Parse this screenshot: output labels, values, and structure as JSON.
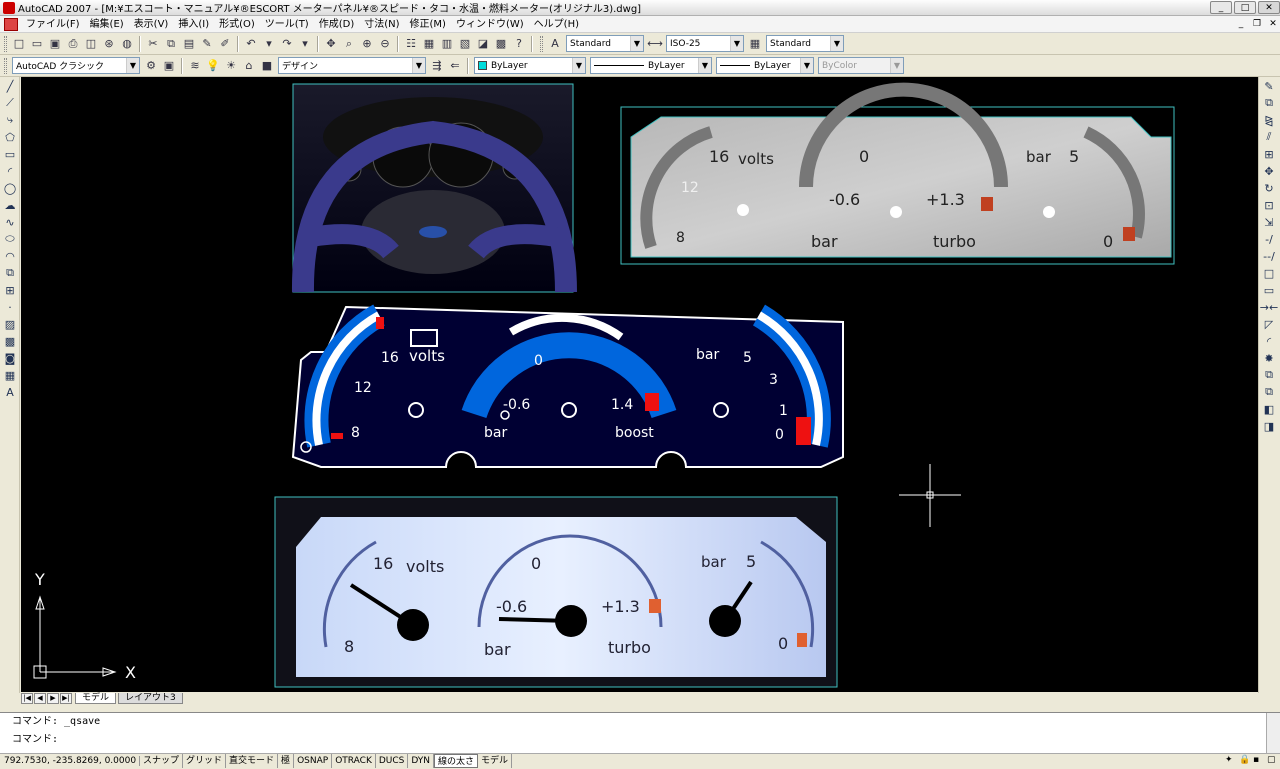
{
  "window": {
    "title": "AutoCAD 2007 - [M:¥エスコート・マニュアル¥®ESCORT メーターパネル¥®スピード・タコ・水温・燃料メーター(オリジナル3).dwg]"
  },
  "menu": [
    "ファイル(F)",
    "編集(E)",
    "表示(V)",
    "挿入(I)",
    "形式(O)",
    "ツール(T)",
    "作成(D)",
    "寸法(N)",
    "修正(M)",
    "ウィンドウ(W)",
    "ヘルプ(H)"
  ],
  "toolbar1": {
    "text_style": "Standard",
    "dim_style": "ISO-25",
    "table_style": "Standard"
  },
  "toolbar2": {
    "workspace": "AutoCAD クラシック",
    "layer": "デザイン",
    "color": "ByLayer",
    "linetype": "ByLayer",
    "lineweight": "ByLayer",
    "plotstyle": "ByColor"
  },
  "tabs": [
    "モデル",
    "レイアウト3"
  ],
  "command": {
    "history": "コマンド: _qsave",
    "prompt": "コマンド:"
  },
  "status": {
    "coords": "792.7530, -235.8269, 0.0000",
    "buttons": [
      "スナップ",
      "グリッド",
      "直交モード",
      "極",
      "OSNAP",
      "OTRACK",
      "DUCS",
      "DYN",
      "線の太さ",
      "モデル"
    ]
  },
  "ucs": {
    "x": "X",
    "y": "Y"
  },
  "gauge_labels": {
    "volts": "volts",
    "v16": "16",
    "v12": "12",
    "v8": "8",
    "b0": "0",
    "bneg": "-0.6",
    "bpos13": "+1.3",
    "bpos14": "1.4",
    "bar": "bar",
    "turbo": "turbo",
    "boost": "boost",
    "o5": "5",
    "o3": "3",
    "o1": "1",
    "o0": "0"
  },
  "colors": {
    "canvas": "#000000",
    "blue": "#0066dd",
    "navy": "#000033",
    "red": "#ee1111",
    "teal": "#40c0c0"
  }
}
